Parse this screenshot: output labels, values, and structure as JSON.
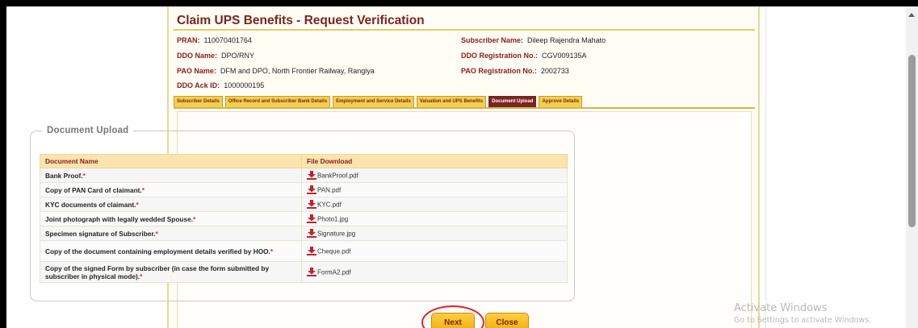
{
  "page": {
    "title": "Claim UPS Benefits - Request Verification"
  },
  "info": {
    "pran_label": "PRAN:",
    "pran_value": "110070401764",
    "subscriber_label": "Subscriber Name:",
    "subscriber_value": "Dileep Rajendra Mahato",
    "ddo_label": "DDO Name:",
    "ddo_value": "DPO/RNY",
    "ddo_reg_label": "DDO Registration No.:",
    "ddo_reg_value": "CGV009135A",
    "pao_label": "PAO Name:",
    "pao_value": "DFM and DPO, North Frontier Railway, Rangiya",
    "pao_reg_label": "PAO Registration No.:",
    "pao_reg_value": "2002733",
    "ack_label": "DDO Ack ID:",
    "ack_value": "1000000195"
  },
  "tabs": [
    {
      "label": "Subscriber Details",
      "active": false
    },
    {
      "label": "Office Record and Subscriber Bank Details",
      "active": false
    },
    {
      "label": "Employment and Service Details",
      "active": false
    },
    {
      "label": "Valuation and UPS Benefits",
      "active": false
    },
    {
      "label": "Document Upload",
      "active": true
    },
    {
      "label": "Approve Details",
      "active": false
    }
  ],
  "upload": {
    "legend": "Document Upload",
    "columns": [
      "Document Name",
      "File Download"
    ],
    "rows": [
      {
        "name": "Bank Proof.",
        "required": "*",
        "file": "BankProof.pdf"
      },
      {
        "name": "Copy of PAN Card of claimant.",
        "required": "*",
        "file": "PAN.pdf"
      },
      {
        "name": "KYC documents of claimant.",
        "required": "*",
        "file": "KYC.pdf"
      },
      {
        "name": "Joint photograph with legally wedded Spouse.",
        "required": "*",
        "file": "Photo1.jpg"
      },
      {
        "name": "Specimen signature of Subscriber.",
        "required": "*",
        "file": "Signature.jpg"
      },
      {
        "name": "Copy of the document containing employment details verified by HOO.",
        "required": "*",
        "file": "Cheque.pdf"
      },
      {
        "name": "Copy of the signed Form by subscriber (in case the form submitted by subscriber in physical mode).",
        "required": "*",
        "file": "FormA2.pdf"
      }
    ]
  },
  "buttons": {
    "next": "Next",
    "close": "Close"
  },
  "watermark": {
    "line1": "Activate Windows",
    "line2": "Go to Settings to activate Windows."
  },
  "colors": {
    "accent": "#7a2520",
    "button": "#f4b321",
    "highlight_ring": "#e1232b",
    "required": "#e0262b"
  }
}
